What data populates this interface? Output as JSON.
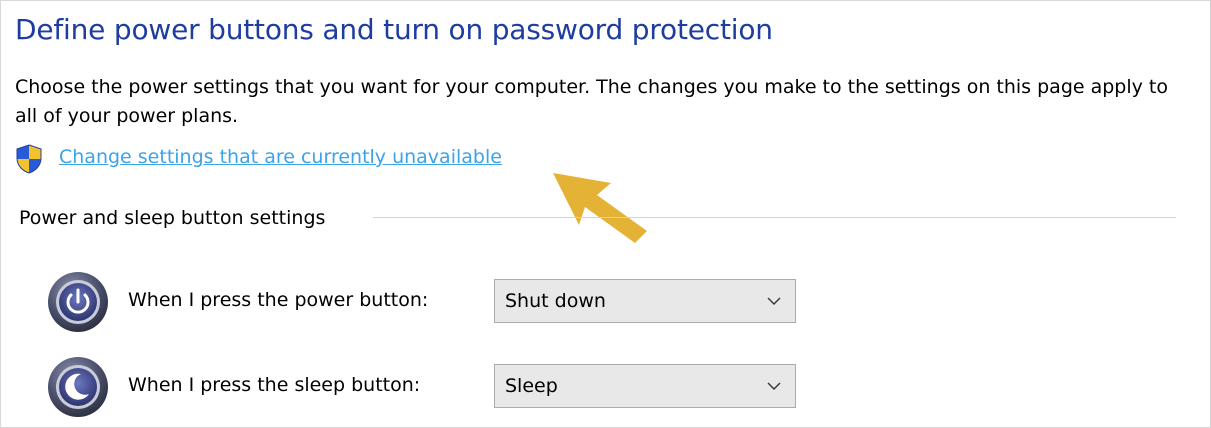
{
  "page": {
    "title": "Define power buttons and turn on password protection",
    "description": "Choose the power settings that you want for your computer. The changes you make to the settings on this page apply to all of your power plans.",
    "change_link": "Change settings that are currently unavailable",
    "shield_icon": "uac-shield-icon",
    "pointer_icon": "arrow-pointer-icon"
  },
  "group": {
    "title": "Power and sleep button settings",
    "rows": [
      {
        "icon": "power-button-icon",
        "label": "When I press the power button:",
        "value": "Shut down"
      },
      {
        "icon": "sleep-button-icon",
        "label": "When I press the sleep button:",
        "value": "Sleep"
      }
    ]
  },
  "colors": {
    "title": "#1e3d9e",
    "link": "#3aa3ea",
    "arrow": "#e3ae2a",
    "dropdown_bg": "#e8e8e8"
  }
}
